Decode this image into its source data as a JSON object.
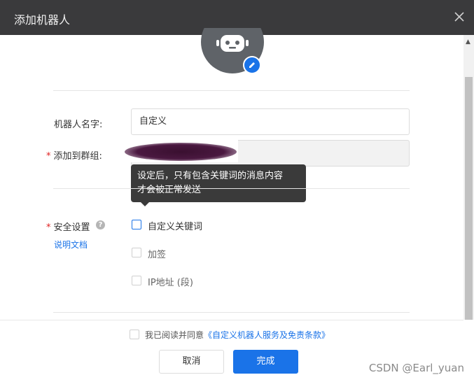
{
  "dialog": {
    "title": "添加机器人"
  },
  "form": {
    "name_label": "机器人名字:",
    "name_value": "自定义",
    "group_label": "添加到群组:",
    "required_mark": "*",
    "tooltip_line1": "设定后，只有包含关键词的消息内容",
    "tooltip_line2": "才会被正常发送",
    "security_label": "安全设置",
    "help_glyph": "?",
    "doc_link": "说明文档",
    "options": [
      {
        "label": "自定义关键词",
        "checked": false
      },
      {
        "label": "加签",
        "checked": false
      },
      {
        "label": "IP地址 (段)",
        "checked": false
      }
    ]
  },
  "footer": {
    "agree_prefix": "我已阅读并同意",
    "agree_link": "《自定义机器人服务及免责条款》",
    "cancel_label": "取消",
    "done_label": "完成"
  },
  "watermark": "CSDN @Earl_yuan",
  "colors": {
    "titlebar": "#3a3a3c",
    "accent": "#1a73e8",
    "required": "#e02020",
    "tooltip": "#3a3a3a"
  },
  "icons": [
    "close-icon",
    "robot-avatar-icon",
    "pencil-icon",
    "help-icon",
    "chevron-up-icon"
  ]
}
